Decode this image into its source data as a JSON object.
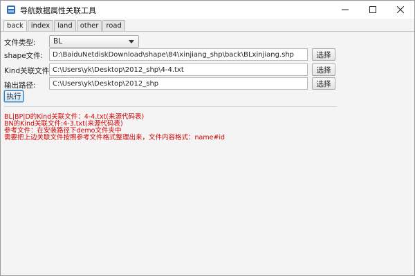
{
  "window": {
    "title": "导航数据属性关联工具"
  },
  "tabs": [
    {
      "label": "back",
      "active": true
    },
    {
      "label": "index",
      "active": false
    },
    {
      "label": "land",
      "active": false
    },
    {
      "label": "other",
      "active": false
    },
    {
      "label": "road",
      "active": false
    }
  ],
  "form": {
    "file_type_label": "文件类型:",
    "file_type_value": "BL",
    "shape_label": "shape文件:",
    "shape_value": "D:\\BaiduNetdiskDownload\\shape\\84\\xinjiang_shp\\back\\BLxinjiang.shp",
    "kind_label": "Kind关联文件:",
    "kind_value": "C:\\Users\\yk\\Desktop\\2012_shp\\4-4.txt",
    "output_label": "输出路径:",
    "output_value": "C:\\Users\\yk\\Desktop\\2012_shp",
    "choose_label": "选择",
    "run_label": "执行"
  },
  "info_lines": [
    "BL|BP|D的Kind关联文件：4-4.txt(来源代码表)",
    "BN的Kind关联文件:4-3.txt(来源代码表)",
    "参考文件：在安装路径下demo文件夹中",
    "需要把上边关联文件按照参考文件格式整理出来，文件内容格式：name#id"
  ],
  "colors": {
    "info_text": "#d40000",
    "app_icon": "#2f6db5",
    "run_button_border": "#3c7fb1"
  },
  "icons": {
    "app": "app-icon",
    "minimize": "minimize-icon",
    "maximize": "maximize-icon",
    "close": "close-icon",
    "dropdown": "chevron-down-icon"
  }
}
